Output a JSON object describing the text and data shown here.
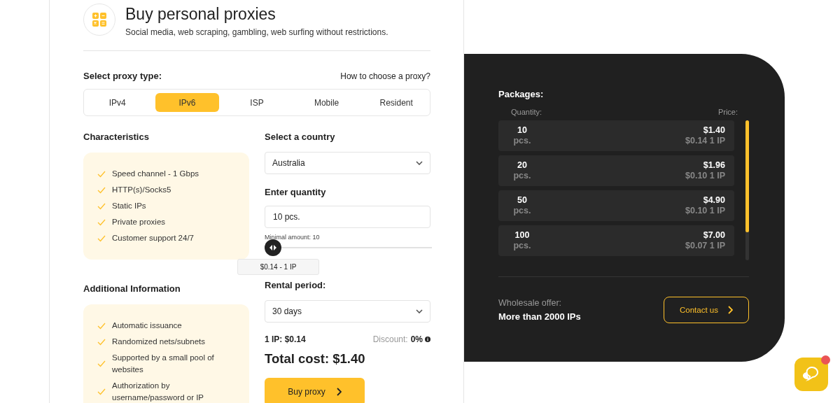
{
  "header": {
    "title": "Buy personal proxies",
    "subtitle": "Social media, web scraping, gambling, web surfing without restrictions."
  },
  "proxy_type": {
    "label": "Select proxy type:",
    "help_link": "How to choose a proxy?",
    "tabs": [
      {
        "label": "IPv4",
        "selected": false
      },
      {
        "label": "IPv6",
        "selected": true
      },
      {
        "label": "ISP",
        "selected": false
      },
      {
        "label": "Mobile",
        "selected": false
      },
      {
        "label": "Resident",
        "selected": false
      }
    ]
  },
  "characteristics": {
    "title": "Characteristics",
    "items": [
      "Speed channel - 1 Gbps",
      "HTTP(s)/Socks5",
      "Static IPs",
      "Private proxies",
      "Customer support 24/7"
    ]
  },
  "additional": {
    "title": "Additional Information",
    "items": [
      "Automatic issuance",
      "Randomized nets/subnets",
      "Supported by a small pool of websites",
      "Authorization by username/password or IP"
    ]
  },
  "country": {
    "label": "Select a country",
    "value": "Australia"
  },
  "quantity": {
    "label": "Enter quantity",
    "value": "10 pcs.",
    "hint": "Minimal amount: 10",
    "slider": {
      "level": 0
    },
    "tooltip": "$0.14 - 1 IP"
  },
  "rental": {
    "label": "Rental period:",
    "value": "30 days"
  },
  "price_per_ip": "1 IP: $0.14",
  "discount": {
    "label": "Discount:",
    "value": "0%"
  },
  "total": "Total cost: $1.40",
  "buy_button": "Buy proxy",
  "packages": {
    "title": "Packages:",
    "col_quantity": "Quantity:",
    "col_price": "Price:",
    "rows": [
      {
        "quantity": "10",
        "unit": "pcs.",
        "price": "$1.40",
        "per_ip": "$0.14 1 IP"
      },
      {
        "quantity": "20",
        "unit": "pcs.",
        "price": "$1.96",
        "per_ip": "$0.10 1 IP"
      },
      {
        "quantity": "50",
        "unit": "pcs.",
        "price": "$4.90",
        "per_ip": "$0.10 1 IP"
      },
      {
        "quantity": "100",
        "unit": "pcs.",
        "price": "$7.00",
        "per_ip": "$0.07 1 IP"
      }
    ]
  },
  "wholesale": {
    "label": "Wholesale offer:",
    "text": "More than 2000 IPs",
    "button": "Contact us"
  }
}
